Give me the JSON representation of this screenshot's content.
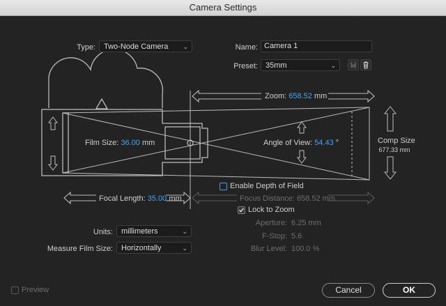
{
  "window": {
    "title": "Camera Settings"
  },
  "type": {
    "label": "Type:",
    "value": "Two-Node Camera"
  },
  "name": {
    "label": "Name:",
    "value": "Camera 1"
  },
  "preset": {
    "label": "Preset:",
    "value": "35mm"
  },
  "zoom": {
    "label": "Zoom:",
    "value": "658.52",
    "unit": "mm"
  },
  "film_size": {
    "label": "Film Size:",
    "value": "36.00",
    "unit": "mm"
  },
  "angle_of_view": {
    "label": "Angle of View:",
    "value": "54.43",
    "unit": "°"
  },
  "comp_size": {
    "label": "Comp Size",
    "value": "677.33 mm"
  },
  "focal_length": {
    "label": "Focal Length:",
    "value": "35.00",
    "unit": "mm"
  },
  "depth_of_field": {
    "label": "Enable Depth of Field",
    "checked": false
  },
  "focus_distance": {
    "label": "Focus Distance:",
    "value": "658.52 mm"
  },
  "lock_to_zoom": {
    "label": "Lock to Zoom",
    "checked": true
  },
  "aperture": {
    "label": "Aperture:",
    "value": "6.25 mm"
  },
  "fstop": {
    "label": "F-Stop:",
    "value": "5.6"
  },
  "blur_level": {
    "label": "Blur Level:",
    "value": "100.0 %"
  },
  "units": {
    "label": "Units:",
    "value": "millimeters"
  },
  "measure_film_size": {
    "label": "Measure Film Size:",
    "value": "Horizontally"
  },
  "preview": {
    "label": "Preview",
    "checked": false
  },
  "buttons": {
    "cancel": "Cancel",
    "ok": "OK"
  },
  "colors": {
    "accent": "#3ea6ff",
    "background": "#232323",
    "line": "#bdbdbd"
  },
  "icons": {
    "save_preset": "save-preset-icon",
    "delete_preset": "trash-icon",
    "checkmark": "checkmark-icon"
  }
}
